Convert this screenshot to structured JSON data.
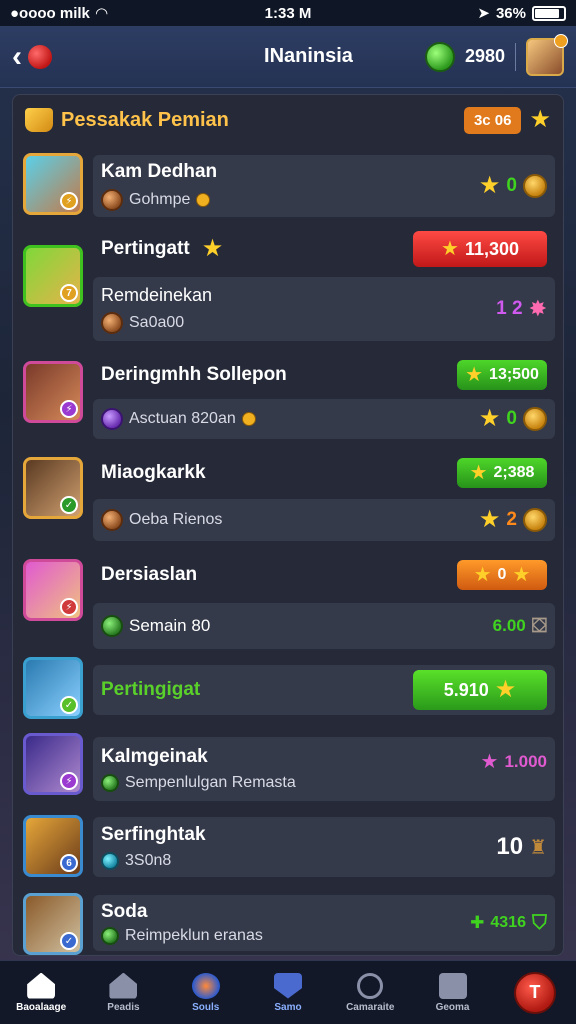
{
  "status_bar": {
    "carrier": "●oooo milk",
    "time": "1:33 M",
    "battery_pct": "36%"
  },
  "header": {
    "title": "INaninsia",
    "coins": "2980"
  },
  "panel": {
    "title": "Pessakak Pemian",
    "badge": "3c 06"
  },
  "rows": [
    {
      "name": "Kam Dedhan",
      "sub": "Gohmpe",
      "right": "0"
    },
    {
      "name": "Pertingatt",
      "pill": "11,300",
      "sub_name": "Remdeinekan",
      "sub": "Sa0a00",
      "right": "1 2"
    },
    {
      "name": "Deringmhh Sollepon",
      "pill": "13;500",
      "sub": "Asctuan 820an",
      "right": "0"
    },
    {
      "name": "Miaogkarkk",
      "pill": "2;388",
      "sub": "Oeba Rienos",
      "right": "2"
    },
    {
      "name": "Dersiaslan",
      "pill": "0",
      "sub": "Semain 80",
      "right": "6.00"
    },
    {
      "name": "Pertingigat",
      "pill": "5.910"
    },
    {
      "name": "Kalmgeinak",
      "sub": "Sempenlulgan Remasta",
      "right": "1.000"
    },
    {
      "name": "Serfinghtak",
      "sub": "3S0n8",
      "right": "10"
    },
    {
      "name": "Soda",
      "sub": "Reimpeklun eranas",
      "right": "4316"
    }
  ],
  "nav": [
    {
      "label": "Baoalaage"
    },
    {
      "label": "Peadis"
    },
    {
      "label": "Souls"
    },
    {
      "label": "Samo"
    },
    {
      "label": "Camaraite"
    },
    {
      "label": "Geoma"
    },
    {
      "label": "T"
    }
  ],
  "colors": {
    "accent_gold": "#ffc24a",
    "green": "#3fc21f",
    "red": "#e0302a",
    "orange": "#e07a1c"
  }
}
